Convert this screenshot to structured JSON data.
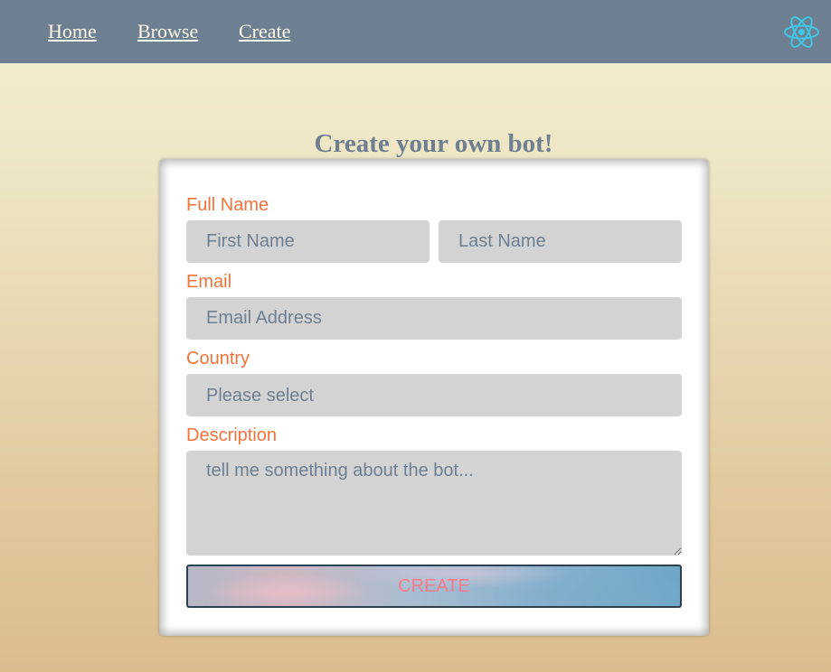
{
  "nav": {
    "home": "Home",
    "browse": "Browse",
    "create": "Create",
    "logo_icon": "react-icon",
    "logo_color": "#3fc7e8",
    "background": "#6e7f91"
  },
  "page": {
    "title": "Create your own bot!"
  },
  "form": {
    "full_name_label": "Full Name",
    "first_name_placeholder": "First Name",
    "last_name_placeholder": "Last Name",
    "email_label": "Email",
    "email_placeholder": "Email Address",
    "country_label": "Country",
    "country_selected": "Please select",
    "description_label": "Description",
    "description_placeholder": "tell me something about the bot...",
    "submit_label": "CREATE"
  },
  "colors": {
    "label": "#f4733a",
    "field_bg": "#d3d3d3",
    "field_text": "#6e7f91",
    "button_text": "#f7798a"
  }
}
